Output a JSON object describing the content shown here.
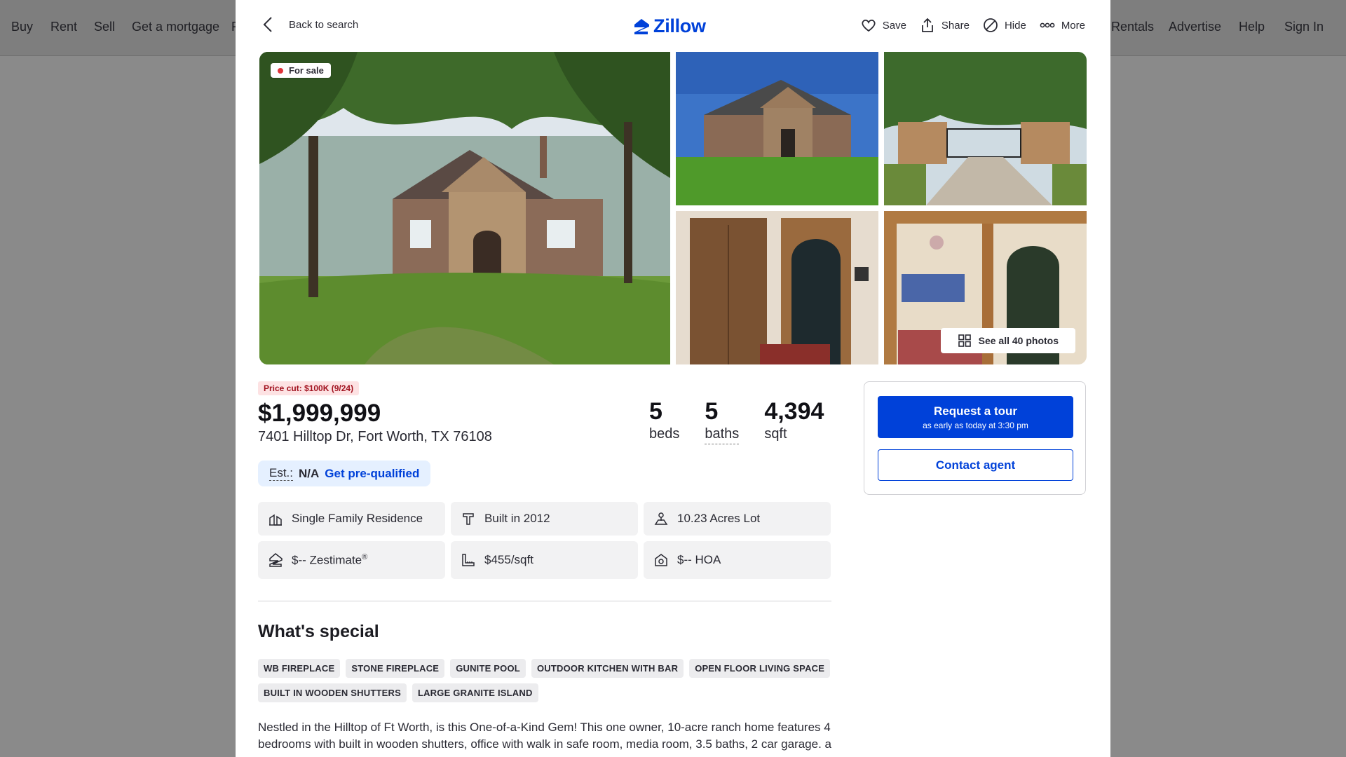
{
  "background_nav": {
    "left_items": [
      "Buy",
      "Rent",
      "Sell",
      "Get a mortgage",
      "F"
    ],
    "right_items": [
      "Rentals",
      "Advertise",
      "Help",
      "Sign In"
    ]
  },
  "header": {
    "back_label": "Back to search",
    "logo_text": "Zillow",
    "actions": {
      "save": "Save",
      "share": "Share",
      "hide": "Hide",
      "more": "More"
    }
  },
  "gallery": {
    "status_badge": "For sale",
    "see_all_label": "See all 40 photos"
  },
  "listing": {
    "price_cut": "Price cut: $100K (9/24)",
    "price": "$1,999,999",
    "address": "7401 Hilltop Dr, Fort Worth, TX 76108",
    "beds_value": "5",
    "beds_label": "beds",
    "baths_value": "5",
    "baths_label": "baths",
    "sqft_value": "4,394",
    "sqft_label": "sqft",
    "est_label": "Est.:",
    "est_value": "N/A",
    "prequalify_label": "Get pre-qualified"
  },
  "tiles": {
    "type": "Single Family Residence",
    "built": "Built in 2012",
    "lot": "10.23 Acres Lot",
    "zestimate": "$-- Zestimate",
    "zestimate_mark": "®",
    "price_per_sqft": "$455/sqft",
    "hoa": "$-- HOA"
  },
  "special": {
    "title": "What's special",
    "chips": [
      "WB FIREPLACE",
      "STONE FIREPLACE",
      "GUNITE POOL",
      "OUTDOOR KITCHEN WITH BAR",
      "OPEN FLOOR LIVING SPACE",
      "BUILT IN WOODEN SHUTTERS",
      "LARGE GRANITE ISLAND"
    ],
    "description": "Nestled in the Hilltop of Ft Worth, is this One-of-a-Kind Gem! This one owner, 10-acre ranch home features 4 bedrooms with built in wooden shutters, office with walk in safe room, media room, 3.5 baths, 2 car garage. a"
  },
  "contact_card": {
    "tour_label": "Request a tour",
    "tour_sublabel": "as early as today at 3:30 pm",
    "contact_label": "Contact agent"
  },
  "colors": {
    "brand_blue": "#0041d9",
    "sale_dot": "#e0343a",
    "price_cut_bg": "#fde2e3"
  }
}
